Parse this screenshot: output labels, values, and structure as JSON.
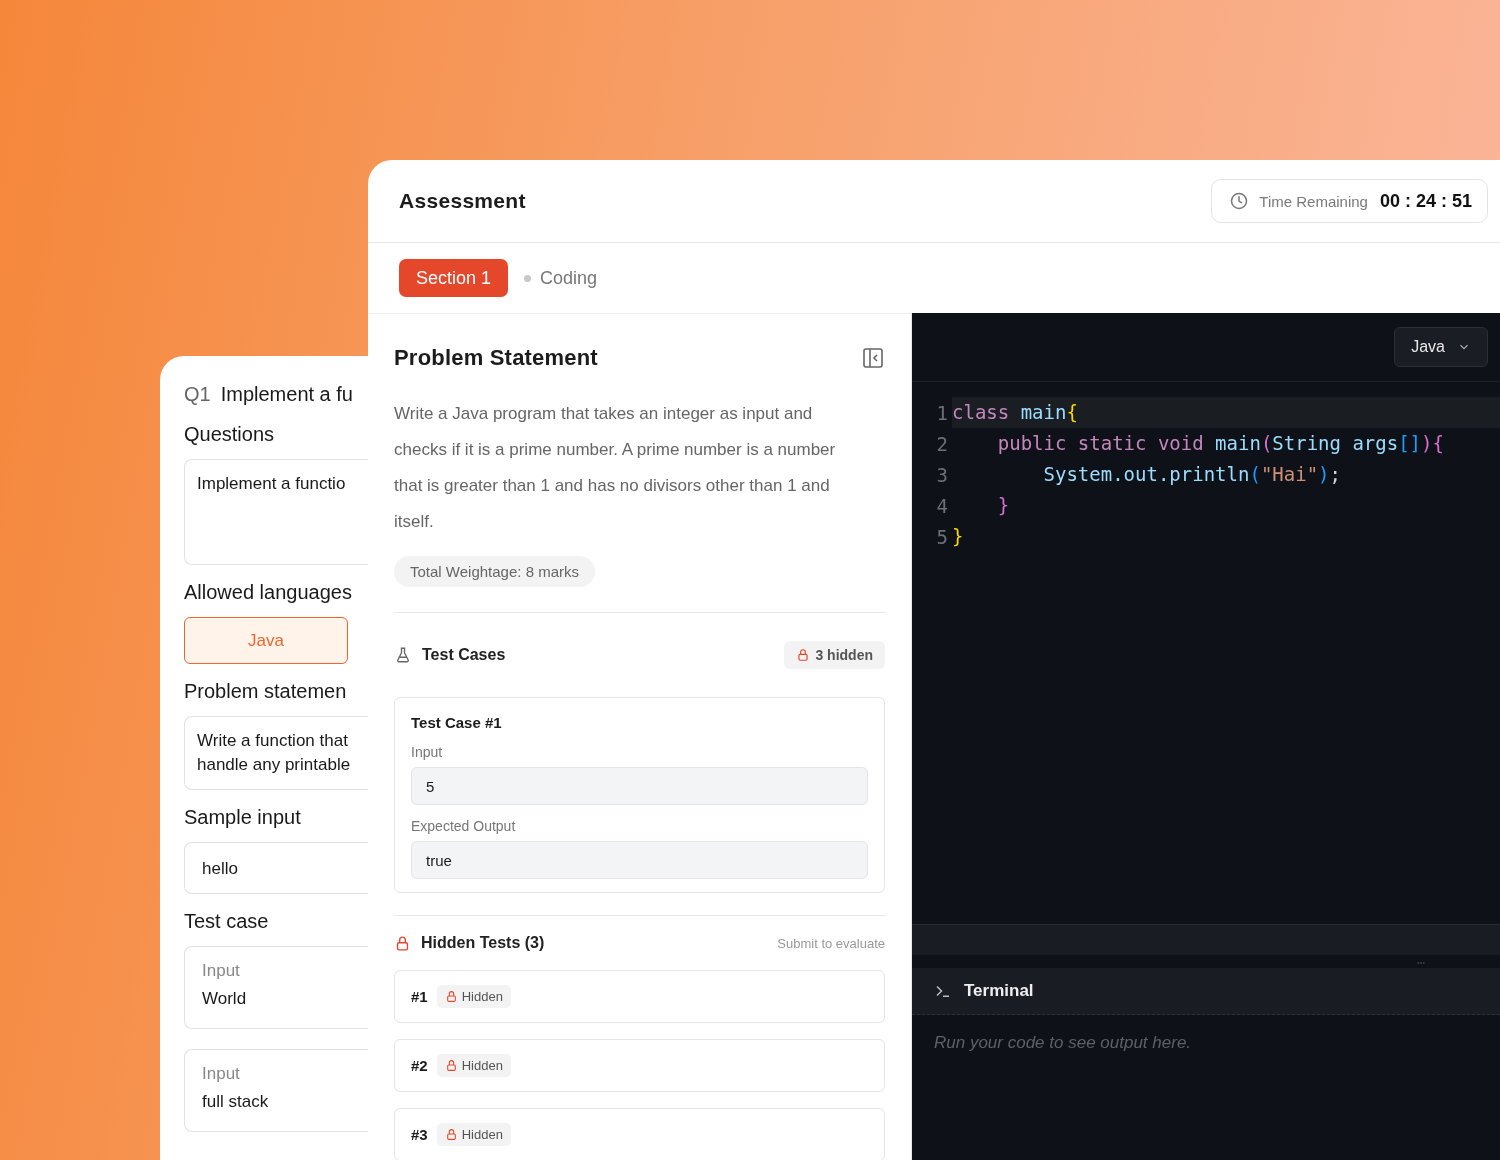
{
  "back_card": {
    "number": "Q1",
    "title": "Implement a fu",
    "fields": [
      {
        "kind": "area",
        "label": "Questions",
        "lines": [
          "Implement a functio"
        ]
      },
      {
        "kind": "chip",
        "label": "Allowed languages",
        "value": "Java",
        "selected": true
      },
      {
        "kind": "area",
        "label": "Problem statemen",
        "lines": [
          "Write a function that",
          "handle any printable"
        ]
      },
      {
        "kind": "input",
        "label": "Sample input",
        "lines": [
          "hello"
        ]
      },
      {
        "kind": "cases",
        "label": "Test case",
        "cases": [
          {
            "label": "Input",
            "value": "World"
          },
          {
            "label": "Input",
            "value": "full stack"
          }
        ]
      }
    ]
  },
  "window": {
    "title": "Assessment",
    "timer": {
      "label": "Time Remaining",
      "value": "00 : 24 : 51"
    }
  },
  "tabs": [
    {
      "label": "Section 1",
      "selected": true
    },
    {
      "label": "Coding",
      "selected": false
    }
  ],
  "problem": {
    "title": "Problem Statement",
    "text": "Write a Java program that takes an integer as input and checks if it is a prime number. A prime number is a number that is greater than 1 and has no divisors other than 1 and itself.",
    "weightage": "Total Weightage: 8 marks"
  },
  "test_cases": {
    "title": "Test Cases",
    "badge": "3 hidden",
    "cases": [
      {
        "title": "Test Case #1",
        "input_label": "Input",
        "input": "5",
        "output_label": "Expected Output",
        "output": "true"
      }
    ]
  },
  "hidden_tests": {
    "title": "Hidden Tests (3)",
    "note": "Submit to evaluate",
    "items": [
      {
        "number": "#1",
        "badge": "Hidden"
      },
      {
        "number": "#2",
        "badge": "Hidden"
      },
      {
        "number": "#3",
        "badge": "Hidden"
      }
    ]
  },
  "editor": {
    "language": "Java",
    "lines": [
      {
        "number": "1",
        "highlighted": true,
        "tokens": [
          {
            "kind": "keyword",
            "text": "class "
          },
          {
            "kind": "name",
            "text": "main"
          },
          {
            "kind": "brace1",
            "text": "{"
          }
        ]
      },
      {
        "number": "2",
        "highlighted": false,
        "tokens": [
          {
            "kind": "keyword",
            "text": "    public static void "
          },
          {
            "kind": "name",
            "text": "main"
          },
          {
            "kind": "brace2",
            "text": "("
          },
          {
            "kind": "name",
            "text": "String args"
          },
          {
            "kind": "brace3",
            "text": "[]"
          },
          {
            "kind": "brace2",
            "text": "){"
          }
        ]
      },
      {
        "number": "3",
        "highlighted": false,
        "tokens": [
          {
            "kind": "name",
            "text": "        System.out.println"
          },
          {
            "kind": "brace3",
            "text": "("
          },
          {
            "kind": "string",
            "text": "\"Hai\""
          },
          {
            "kind": "brace3",
            "text": ")"
          },
          {
            "kind": "punct",
            "text": ";"
          }
        ]
      },
      {
        "number": "4",
        "highlighted": false,
        "tokens": [
          {
            "kind": "brace2",
            "text": "    }"
          }
        ]
      },
      {
        "number": "5",
        "highlighted": false,
        "tokens": [
          {
            "kind": "brace1",
            "text": "}"
          }
        ]
      }
    ]
  },
  "terminal": {
    "title": "Terminal",
    "message": "Run your code to see output here."
  }
}
